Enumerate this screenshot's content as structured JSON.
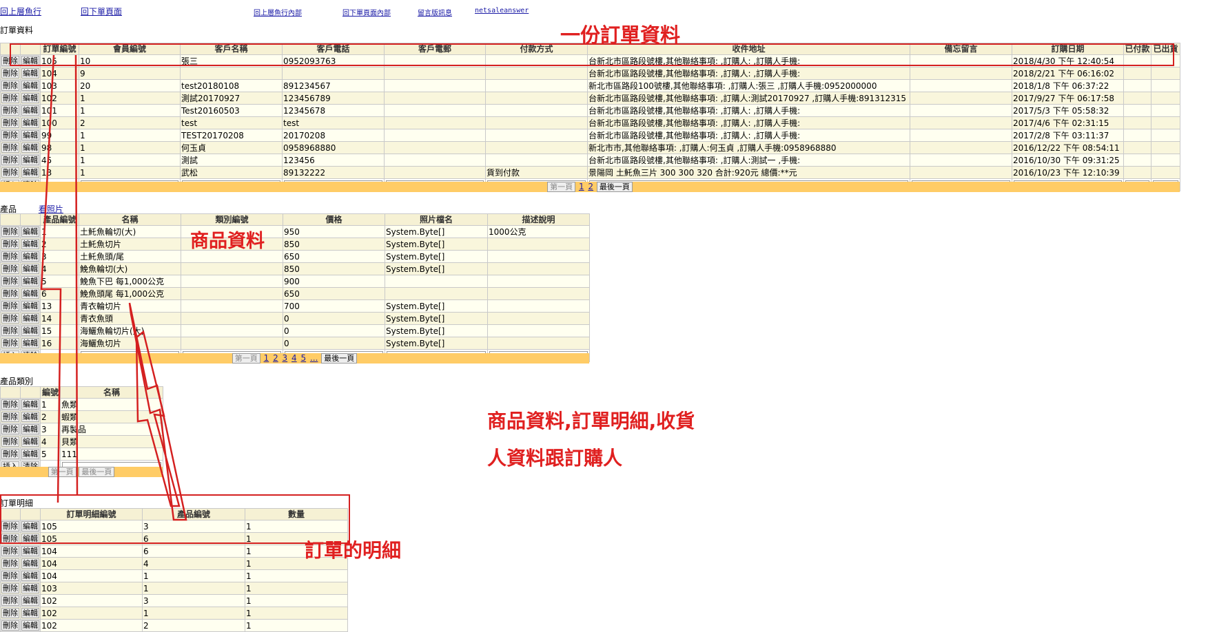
{
  "nav": {
    "links": [
      "回上層魚行",
      "回下單頁面",
      "回上層魚行內部",
      "回下單頁面內部",
      "留言版訊息",
      "netsaleanswer"
    ]
  },
  "orders": {
    "label": "訂單資料",
    "columns": [
      "訂單編號",
      "會員編號",
      "客戶名稱",
      "客戶電話",
      "客戶電郵",
      "付款方式",
      "收件地址",
      "備忘留言",
      "訂購日期",
      "已付款",
      "已出貨"
    ],
    "rows": [
      [
        "105",
        "10",
        "張三",
        "0952093763",
        "",
        "",
        "台新北市區路段號樓,其他聯絡事項: ,訂購人: ,訂購人手機:",
        "",
        "2018/4/30 下午 12:40:54",
        "",
        ""
      ],
      [
        "104",
        "9",
        "",
        "",
        "",
        "",
        "台新北市區路段號樓,其他聯絡事項: ,訂購人: ,訂購人手機:",
        "",
        "2018/2/21 下午 06:16:02",
        "",
        ""
      ],
      [
        "103",
        "20",
        "test20180108",
        "891234567",
        "",
        "",
        "新北市區路段100號樓,其他聯絡事項: ,訂購人:張三 ,訂購人手機:0952000000",
        "",
        "2018/1/8 下午 06:37:22",
        "",
        ""
      ],
      [
        "102",
        "1",
        "測試20170927",
        "123456789",
        "",
        "",
        "台新北市區路段號樓,其他聯絡事項: ,訂購人:測試20170927 ,訂購人手機:891312315",
        "",
        "2017/9/27 下午 06:17:58",
        "",
        ""
      ],
      [
        "101",
        "1",
        "Test20160503",
        "12345678",
        "",
        "",
        "台新北市區路段號樓,其他聯絡事項: ,訂購人: ,訂購人手機:",
        "",
        "2017/5/3 下午 05:58:32",
        "",
        ""
      ],
      [
        "100",
        "2",
        "test",
        "test",
        "",
        "",
        "台新北市區路段號樓,其他聯絡事項: ,訂購人: ,訂購人手機:",
        "",
        "2017/4/6 下午 02:31:15",
        "",
        ""
      ],
      [
        "99",
        "1",
        "TEST20170208",
        "20170208",
        "",
        "",
        "台新北市區路段號樓,其他聯絡事項: ,訂購人: ,訂購人手機:",
        "",
        "2017/2/8 下午 03:11:37",
        "",
        ""
      ],
      [
        "98",
        "1",
        "何玉貞",
        "0958968880",
        "",
        "",
        "新北市市,其他聯絡事項: ,訂購人:何玉貞 ,訂購人手機:0958968880",
        "",
        "2016/12/22 下午 08:54:11",
        "",
        ""
      ],
      [
        "45",
        "1",
        "測試",
        "123456",
        "",
        "",
        "台新北市區路段號樓,其他聯絡事項: ,訂購人:測試一 ,手機:",
        "",
        "2016/10/30 下午 09:31:25",
        "",
        ""
      ],
      [
        "13",
        "1",
        "武松",
        "89132222",
        "",
        "貨到付款",
        "景陽岡 土魠魚三片 300 300 320 合計:920元 總價:**元",
        "",
        "2016/10/23 下午 12:10:39",
        "",
        ""
      ]
    ],
    "pager": {
      "first": "第一頁",
      "pages": [
        "1",
        "2"
      ],
      "last": "最後一頁"
    }
  },
  "products": {
    "label": "產品",
    "photo_link": "看照片",
    "columns": [
      "產品編號",
      "名稱",
      "類別編號",
      "價格",
      "照片檔名",
      "描述說明"
    ],
    "rows": [
      [
        "1",
        "土魠魚輪切(大)",
        "",
        "950",
        "System.Byte[]",
        "1000公克"
      ],
      [
        "2",
        "土魠魚切片",
        "",
        "850",
        "System.Byte[]",
        ""
      ],
      [
        "3",
        "土魠魚頭/尾",
        "",
        "650",
        "System.Byte[]",
        ""
      ],
      [
        "4",
        "鮸魚輪切(大)",
        "",
        "850",
        "System.Byte[]",
        ""
      ],
      [
        "5",
        "鮸魚下巴 每1,000公克",
        "",
        "900",
        "",
        ""
      ],
      [
        "6",
        "鮸魚頭尾 每1,000公克",
        "",
        "650",
        "",
        ""
      ],
      [
        "13",
        "青衣輪切片",
        "",
        "700",
        "System.Byte[]",
        ""
      ],
      [
        "14",
        "青衣魚頭",
        "",
        "0",
        "System.Byte[]",
        ""
      ],
      [
        "15",
        "海鱺魚輪切片(大)",
        "",
        "0",
        "System.Byte[]",
        ""
      ],
      [
        "16",
        "海鱺魚切片",
        "",
        "0",
        "System.Byte[]",
        ""
      ]
    ],
    "pager": {
      "first": "第一頁",
      "pages": [
        "1",
        "2",
        "3",
        "4",
        "5",
        "..."
      ],
      "last": "最後一頁"
    }
  },
  "categories": {
    "label": "產品類別",
    "columns": [
      "編號",
      "名稱"
    ],
    "rows": [
      [
        "1",
        "魚類"
      ],
      [
        "2",
        "蝦類"
      ],
      [
        "3",
        "再製品"
      ],
      [
        "4",
        "貝類"
      ],
      [
        "5",
        "111"
      ]
    ],
    "pager": {
      "first": "第一頁",
      "last": "最後一頁"
    }
  },
  "details": {
    "label": "訂單明細",
    "columns": [
      "訂單明細編號",
      "產品編號",
      "數量"
    ],
    "rows": [
      [
        "105",
        "3",
        "1"
      ],
      [
        "105",
        "6",
        "1"
      ],
      [
        "104",
        "6",
        "1"
      ],
      [
        "104",
        "4",
        "1"
      ],
      [
        "104",
        "1",
        "1"
      ],
      [
        "103",
        "1",
        "1"
      ],
      [
        "102",
        "3",
        "1"
      ],
      [
        "102",
        "1",
        "1"
      ],
      [
        "102",
        "2",
        "1"
      ]
    ]
  },
  "buttons": {
    "delete": "刪除",
    "edit": "編輯",
    "insert": "插入",
    "clear": "清除"
  },
  "annotations": {
    "order_note": "一份訂單資料",
    "product_note": "商品資料",
    "relation_note_line1": "商品資料,訂單明細,收貨",
    "relation_note_line2": "人資料跟訂購人",
    "detail_note": "訂單的明細"
  },
  "colors": {
    "annotation": "#d42020",
    "pager": "#ffcc66",
    "header": "#f6f1d4",
    "row": "#fffff0"
  }
}
